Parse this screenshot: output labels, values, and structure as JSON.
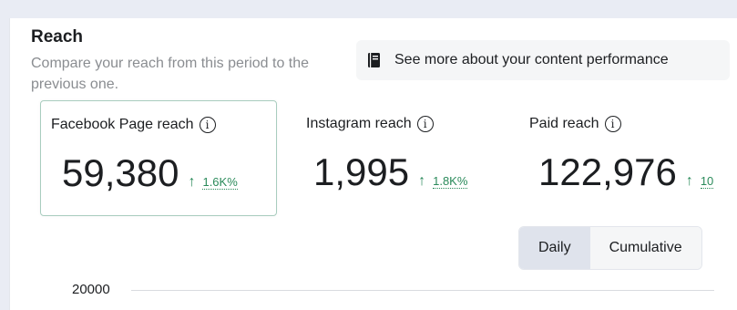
{
  "header": {
    "title": "Reach",
    "subtitle": "Compare your reach from this period to the previous one."
  },
  "more_button": {
    "label": "See more about your content performance",
    "icon": "book-icon"
  },
  "metrics": [
    {
      "label": "Facebook Page reach",
      "value": "59,380",
      "change": "1.6K%",
      "trend": "up"
    },
    {
      "label": "Instagram reach",
      "value": "1,995",
      "change": "1.8K%",
      "trend": "up"
    },
    {
      "label": "Paid reach",
      "value": "122,976",
      "change": "10",
      "trend": "up"
    }
  ],
  "toggle": {
    "options": [
      "Daily",
      "Cumulative"
    ],
    "selected": "Daily"
  },
  "chart": {
    "y_tick": "20000"
  },
  "colors": {
    "positive": "#2a8a5a",
    "active_border": "#a9cdbf",
    "selected_toggle": "#dfe3ec"
  }
}
